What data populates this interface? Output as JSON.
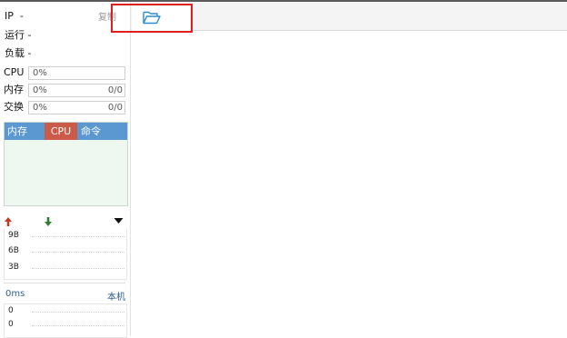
{
  "server_info": {
    "ip_label": "IP",
    "ip_value": "-",
    "uptime_label": "运行",
    "uptime_value": "-",
    "load_label": "负载",
    "load_value": "-",
    "copy_label": "复制"
  },
  "meters": {
    "cpu": {
      "label": "CPU",
      "percent": "0%",
      "amount": "",
      "fraction": 0
    },
    "memory": {
      "label": "内存",
      "percent": "0%",
      "amount": "0/0",
      "fraction": 0
    },
    "swap": {
      "label": "交换",
      "percent": "0%",
      "amount": "0/0",
      "fraction": 0
    }
  },
  "process_table": {
    "columns": [
      "内存",
      "CPU",
      "命令"
    ],
    "rows": []
  },
  "network": {
    "upload_icon": "arrow-up-icon",
    "download_icon": "arrow-down-icon",
    "menu_icon": "caret-down-icon",
    "ticks": [
      "9B",
      "6B",
      "3B"
    ]
  },
  "ping": {
    "latency": "0ms",
    "target": "本机",
    "ticks": [
      "0",
      "0"
    ]
  },
  "tabs": {
    "active_icon": "folder-open-icon"
  },
  "colors": {
    "table_header": "#5b97d0",
    "cpu_column": "#cc5a49",
    "upload_arrow": "#c23a21",
    "download_arrow": "#2e7d32",
    "highlight": "#e01e1e",
    "folder_icon": "#2a8bd1"
  }
}
